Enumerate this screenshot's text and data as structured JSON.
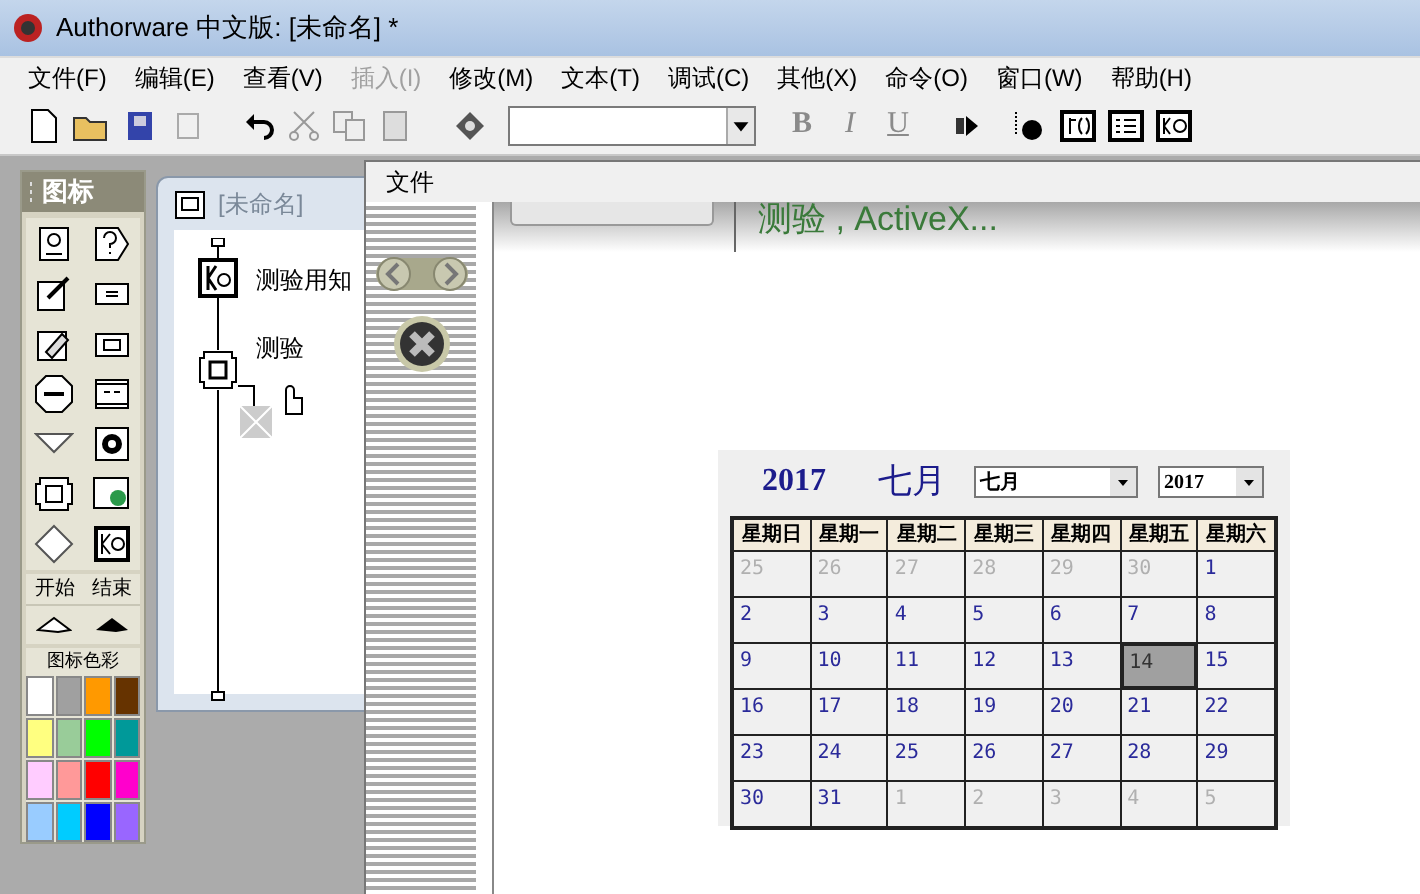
{
  "window": {
    "title": "Authorware 中文版: [未命名] *"
  },
  "menu": [
    {
      "label": "文件(F)",
      "disabled": false
    },
    {
      "label": "编辑(E)",
      "disabled": false
    },
    {
      "label": "查看(V)",
      "disabled": false
    },
    {
      "label": "插入(I)",
      "disabled": true
    },
    {
      "label": "修改(M)",
      "disabled": false
    },
    {
      "label": "文本(T)",
      "disabled": false
    },
    {
      "label": "调试(C)",
      "disabled": false
    },
    {
      "label": "其他(X)",
      "disabled": false
    },
    {
      "label": "命令(O)",
      "disabled": false
    },
    {
      "label": "窗口(W)",
      "disabled": false
    },
    {
      "label": "帮助(H)",
      "disabled": false
    }
  ],
  "format_buttons": [
    {
      "label": "B",
      "disabled": true
    },
    {
      "label": "I",
      "disabled": true
    },
    {
      "label": "U",
      "disabled": true
    }
  ],
  "palette": {
    "title": "图标",
    "start_label": "开始",
    "end_label": "结束",
    "color_label": "图标色彩",
    "colors": [
      {
        "color": "#ffffff"
      },
      {
        "color": "#a0a0a0"
      },
      {
        "color": "#ff9900"
      },
      {
        "color": "#663300"
      },
      {
        "color": "#ffff80"
      },
      {
        "color": "#99cc99"
      },
      {
        "color": "#00ff00"
      },
      {
        "color": "#009999"
      },
      {
        "color": "#ffccff"
      },
      {
        "color": "#ff9999"
      },
      {
        "color": "#ff0000"
      },
      {
        "color": "#ff00cc"
      },
      {
        "color": "#99ccff"
      },
      {
        "color": "#00ccff"
      },
      {
        "color": "#0000ff"
      },
      {
        "color": "#9966ff"
      }
    ]
  },
  "design_window": {
    "title": "[未命名]",
    "flow": [
      {
        "label": "测验用知",
        "kind": "knowledge"
      },
      {
        "label": "测验",
        "kind": "interaction"
      }
    ]
  },
  "presentation": {
    "menu": "文件",
    "banner": "测验 , ActiveX...",
    "calendar": {
      "year": "2017",
      "month": "七月",
      "month_select": "七月",
      "year_select": "2017",
      "weekdays": [
        "星期日",
        "星期一",
        "星期二",
        "星期三",
        "星期四",
        "星期五",
        "星期六"
      ],
      "weeks": [
        [
          {
            "label": "25",
            "muted": true,
            "selected": false
          },
          {
            "label": "26",
            "muted": true,
            "selected": false
          },
          {
            "label": "27",
            "muted": true,
            "selected": false
          },
          {
            "label": "28",
            "muted": true,
            "selected": false
          },
          {
            "label": "29",
            "muted": true,
            "selected": false
          },
          {
            "label": "30",
            "muted": true,
            "selected": false
          },
          {
            "label": "1",
            "muted": false,
            "selected": false
          }
        ],
        [
          {
            "label": "2",
            "muted": false,
            "selected": false
          },
          {
            "label": "3",
            "muted": false,
            "selected": false
          },
          {
            "label": "4",
            "muted": false,
            "selected": false
          },
          {
            "label": "5",
            "muted": false,
            "selected": false
          },
          {
            "label": "6",
            "muted": false,
            "selected": false
          },
          {
            "label": "7",
            "muted": false,
            "selected": false
          },
          {
            "label": "8",
            "muted": false,
            "selected": false
          }
        ],
        [
          {
            "label": "9",
            "muted": false,
            "selected": false
          },
          {
            "label": "10",
            "muted": false,
            "selected": false
          },
          {
            "label": "11",
            "muted": false,
            "selected": false
          },
          {
            "label": "12",
            "muted": false,
            "selected": false
          },
          {
            "label": "13",
            "muted": false,
            "selected": false
          },
          {
            "label": "14",
            "muted": false,
            "selected": true
          },
          {
            "label": "15",
            "muted": false,
            "selected": false
          }
        ],
        [
          {
            "label": "16",
            "muted": false,
            "selected": false
          },
          {
            "label": "17",
            "muted": false,
            "selected": false
          },
          {
            "label": "18",
            "muted": false,
            "selected": false
          },
          {
            "label": "19",
            "muted": false,
            "selected": false
          },
          {
            "label": "20",
            "muted": false,
            "selected": false
          },
          {
            "label": "21",
            "muted": false,
            "selected": false
          },
          {
            "label": "22",
            "muted": false,
            "selected": false
          }
        ],
        [
          {
            "label": "23",
            "muted": false,
            "selected": false
          },
          {
            "label": "24",
            "muted": false,
            "selected": false
          },
          {
            "label": "25",
            "muted": false,
            "selected": false
          },
          {
            "label": "26",
            "muted": false,
            "selected": false
          },
          {
            "label": "27",
            "muted": false,
            "selected": false
          },
          {
            "label": "28",
            "muted": false,
            "selected": false
          },
          {
            "label": "29",
            "muted": false,
            "selected": false
          }
        ],
        [
          {
            "label": "30",
            "muted": false,
            "selected": false
          },
          {
            "label": "31",
            "muted": false,
            "selected": false
          },
          {
            "label": "1",
            "muted": true,
            "selected": false
          },
          {
            "label": "2",
            "muted": true,
            "selected": false
          },
          {
            "label": "3",
            "muted": true,
            "selected": false
          },
          {
            "label": "4",
            "muted": true,
            "selected": false
          },
          {
            "label": "5",
            "muted": true,
            "selected": false
          }
        ]
      ]
    }
  }
}
